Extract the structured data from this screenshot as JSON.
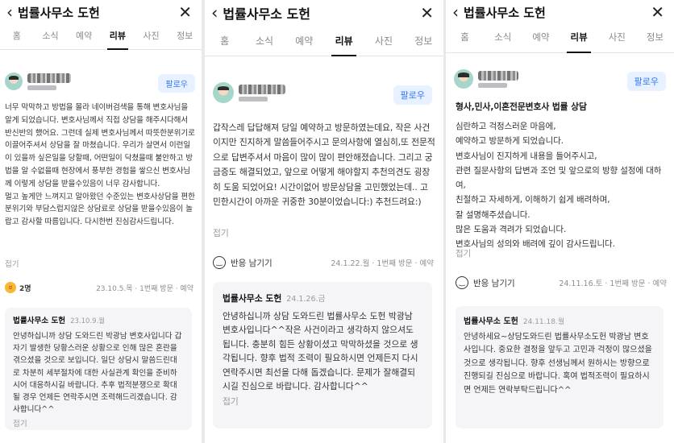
{
  "app": {
    "title": "법률사무소 도헌",
    "back_icon": "‹",
    "close_icon": "✕"
  },
  "tabs": [
    "홈",
    "소식",
    "예약",
    "리뷰",
    "사진",
    "정보"
  ],
  "active_tab": "리뷰",
  "follow_label": "팔로우",
  "fold_label": "접기",
  "reviews": [
    {
      "body": "너무 막막하고 방법을 몰라 네이버검색을 통해 변호사님을 알게 되었습니다. 변호사님께서 직접 상담을 해주시다해서 반신반의 했어요. 그런데 실제 변호사님께서 따뜻한분위기로 이끌어주셔서 상담을 잘 마쳤습니다. 우리가 살면서 이런일이 있을까 싶은일을 당할때, 어떤일이 닥쳤을때 불안하고 방법을 알 수없을때 현장에서 풍부한 경험을 쌓으신 변호사님께 이렇게 상담을 받을수있음이 너무 감사합니다.\n멀고 높게만 느껴지고 알아왔던 수준있는 변호사상담을 편한분위기와 부담스럽지않은 상담료로 상담을 받을수있음이 놀랍고 감사할 따름입니다. 다시한번 진심감사드립니다.",
      "reaction_count": "2명",
      "visit_info": "23.10.5.목 · 1번째 방문 · 예약",
      "reply": {
        "name": "법률사무소 도헌",
        "date": "23.10.9.월",
        "text": "안녕하십니까 상담 도와드린 박광남 변호사입니다 갑자기 발생한 당황스러운 상황으로 인해 많은 혼란을 겪으셨을 것으로 보입니다. 일단 상담시 말씀드린대로 차분히 세부절차에 대한 사실관계 확인을 준비하시어 대응하시길 바랍니다. 추후 법적분쟁으로 확대될 경우 언제든 연락주시면 조력해드리겠습니다. 감사합니다^^"
      }
    },
    {
      "body": "갑작스레 답답해져 당일 예약하고 방문하였는데요, 작은 사건이지만 진지하게 말씀들어주시고 문의사항에 열심히,또 전문적으로 답변주셔서 마음이 많이 많이 편안해졌습니다. 그리고 궁금증도 해결되었고, 앞으로 어떻게 해야할지 추천의견도 굉장히 도움 되었어요! 시간이없어 방문상담을 고민했었는데.. 고민한시간이 아까운 귀중한 30분이었습니다:) 추천드려요:)",
      "reaction_label": "반응 남기기",
      "visit_info": "24.1.22.월 · 1번째 방문 · 예약",
      "reply": {
        "name": "법률사무소 도헌",
        "date": "24.1.26.금",
        "text": "안녕하십니까 상담 도와드린 법률사무소 도헌 박광남 변호사입니다^^작은 사건이라고 생각하지 않으셔도 됩니다. 충분히 힘든 상황이셨고 막막하셨을 것으로 생각됩니다. 향후 법적 조력이 필요하시면 언제든지 다시 연락주시면 최선을 다해 돕겠습니다. 문제가 잘해결되시길 진심으로 바랍니다. 감사합니다^^"
      }
    },
    {
      "headline": "형사,민사,이혼전문변호사 법률 상담",
      "body": "심란하고 걱정스러운 마음에,\n예약하고 방문하게 되었습니다.\n변호사님이 진지하게 내용을 들어주시고,\n관련 질문사항의 답변과 조언 및 앞으로의 방향 설정에 대하여,\n친절하고 자세하게, 이해하기 쉽게 배려하며,\n잘 설명해주셨습니다.\n많은 도움과 격려가 되었습니다.\n변호사님의 성의와 배려에 깊이 감사드립니다.",
      "reaction_label": "반응 남기기",
      "visit_info": "24.11.16.토 · 1번째 방문 · 예약",
      "reply": {
        "name": "법률사무소 도헌",
        "date": "24.11.18.월",
        "text": "안녕하세요~상담도와드린 법률사무소도헌 박광남 변호사입니다. 중요한 결정을 앞두고 고민과 걱정이 많으셨을것으로 생각됩니다. 향후 선생님께서 원하시는 방향으로 진행되길 진심으로 바랍니다. 혹여 법적조력이 필요하시면 언제든 연락부탁드립니다^^"
      }
    }
  ]
}
